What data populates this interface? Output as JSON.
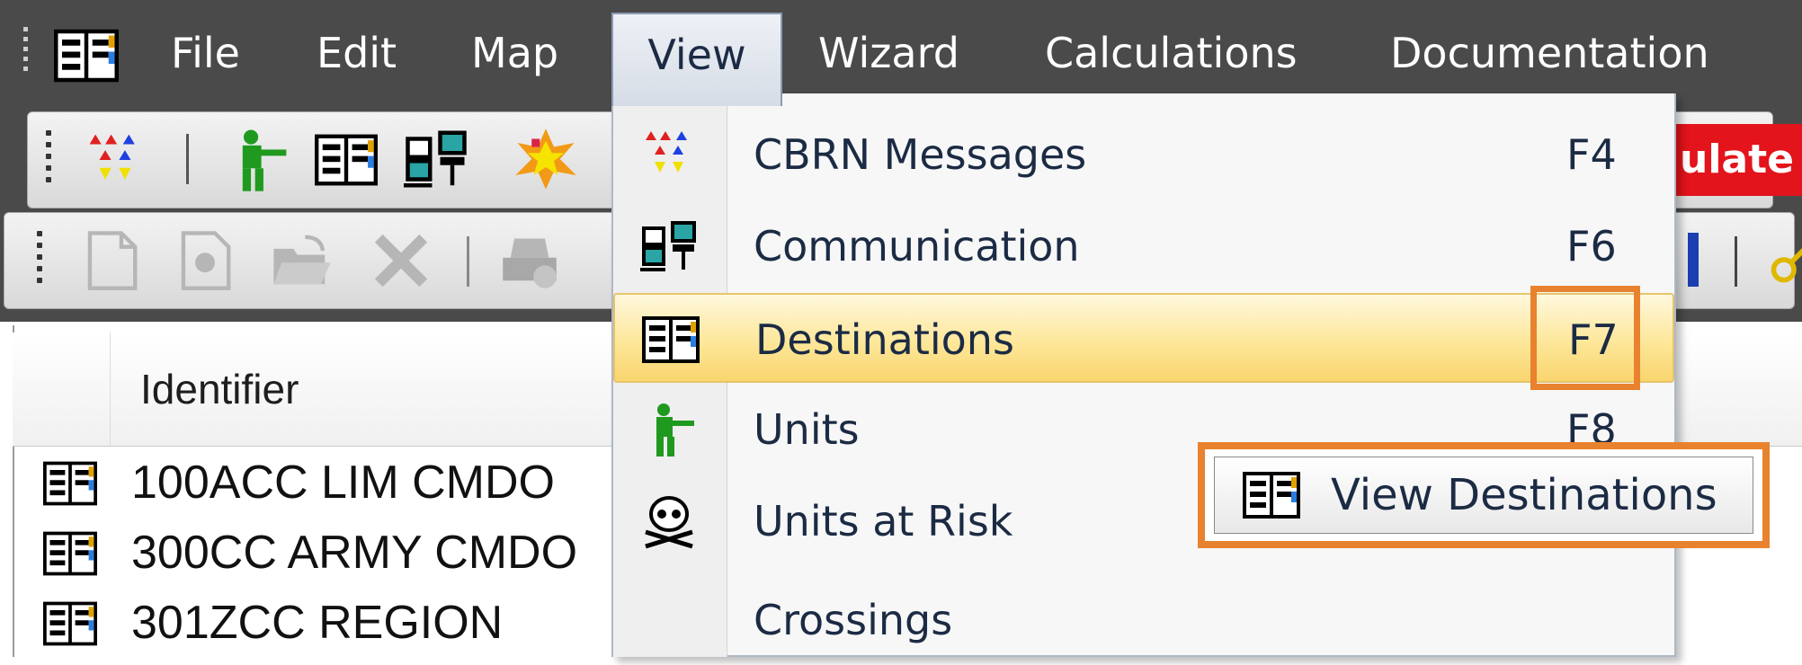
{
  "menubar": {
    "items": [
      "File",
      "Edit",
      "Map",
      "View",
      "Wizard",
      "Calculations",
      "Documentation"
    ],
    "active": "View"
  },
  "toolbar": {
    "calculate_label": "ulate"
  },
  "list": {
    "column_identifier": "Identifier",
    "rows": [
      "100ACC LIM CMDO",
      "300CC ARMY CMDO",
      "301ZCC REGION"
    ]
  },
  "view_menu": {
    "items": [
      {
        "label": "CBRN Messages",
        "shortcut": "F4",
        "icon": "cbrn-messages-icon"
      },
      {
        "label": "Communication",
        "shortcut": "F6",
        "icon": "communication-icon"
      },
      {
        "label": "Destinations",
        "shortcut": "F7",
        "icon": "destinations-book-icon"
      },
      {
        "label": "Units",
        "shortcut": "F8",
        "icon": "soldier-unit-icon"
      },
      {
        "label": "Units at Risk",
        "shortcut": "",
        "icon": "skull-icon"
      },
      {
        "label": "Crossings",
        "shortcut": "",
        "icon": ""
      }
    ],
    "highlighted": "Destinations"
  },
  "tooltip": {
    "text": "View Destinations"
  },
  "colors": {
    "menubar_bg": "#4a4a4a",
    "highlight_orange": "#e8822e",
    "calculate_red": "#e3141b"
  }
}
